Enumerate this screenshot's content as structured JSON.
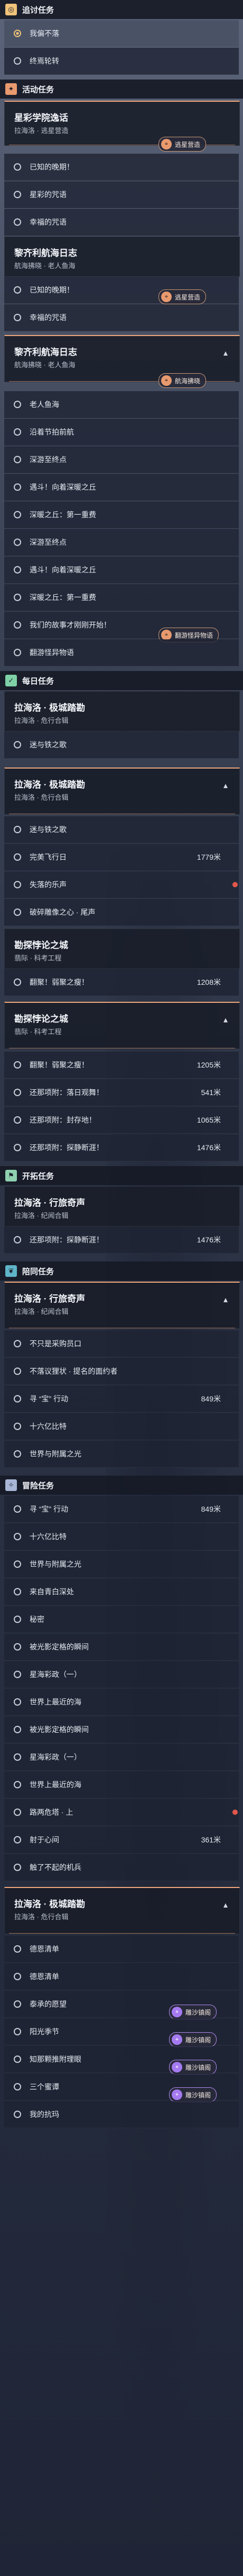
{
  "colors": {
    "accent": "#f1a77b",
    "daily": "#7fd0a6",
    "event": "#e89a6e",
    "feature": "#8fd0b0",
    "companion": "#5fb4c8",
    "purple": "#a57af0"
  },
  "sections": {
    "side": {
      "title": "追讨任务",
      "icon": "target-icon"
    },
    "event": {
      "title": "活动任务",
      "icon": "star-icon"
    },
    "daily": {
      "title": "每日任务",
      "icon": "check-icon"
    },
    "feature": {
      "title": "开拓任务",
      "icon": "flag-icon"
    },
    "companion": {
      "title": "陪同任务",
      "icon": "leaf-icon"
    },
    "adventure": {
      "title": "冒险任务",
      "icon": "compass-icon"
    }
  },
  "side_rows": [
    "我偏不落",
    "终焉轮转"
  ],
  "cards": {
    "c1": {
      "title": "星彩学院逸话",
      "sub": "拉海洛 · 逃星营造"
    },
    "c2": {
      "title": "黎齐利航海日志",
      "sub": "航海拂晓 · 老人鱼海"
    },
    "c3": {
      "title": "黎齐利航海日志",
      "sub": "航海拂晓 · 老人鱼海"
    },
    "c4": {
      "title": "拉海洛 · 极城踏勘",
      "sub": "拉海洛 · 危行合辑"
    },
    "c5": {
      "title": "拉海洛 · 极城踏勘",
      "sub": "拉海洛 · 危行合辑"
    },
    "c6": {
      "title": "勘探悖论之城",
      "sub": "翡际 · 科考工程"
    },
    "c7": {
      "title": "勘探悖论之城",
      "sub": "翡际 · 科考工程"
    },
    "c8": {
      "title": "拉海洛 · 行旅奇声",
      "sub": "拉海洛 · 纪闻合辑"
    },
    "c9": {
      "title": "拉海洛 · 行旅奇声",
      "sub": "拉海洛 · 纪闻合辑"
    },
    "c10": {
      "title": "拉海洛 · 极城踏勘",
      "sub": "拉海洛 · 危行合辑"
    }
  },
  "rows": {
    "c1": [
      "已知的晚期！",
      "星彩的咒语",
      "幸福的咒语"
    ],
    "c2": [
      "已知的晚期！",
      "幸福的咒语"
    ],
    "c3": [
      "老人鱼海",
      "沿着节拍前航",
      "深游至终点",
      "遇斗！向着深暖之丘",
      "深暖之丘：第一重费",
      "深游至终点",
      "遇斗！向着深暖之丘",
      "深暖之丘：第一重费",
      "我们的故事才刚刚开始！",
      "翻游怪异物语"
    ],
    "c4": [
      "迷与铁之歌"
    ],
    "c5": [
      "迷与铁之歌",
      "完美飞行日",
      "失落的乐声",
      "破碎雕像之心 · 尾声"
    ],
    "c6": [
      "翻聚！弱聚之瘦！"
    ],
    "c7": [
      "翻聚！弱聚之瘦！",
      "还那项附：落日观舞！",
      "还那项附：封存地！",
      "还那项附：探静断涯！"
    ],
    "c8": [
      "还那项附：探静断涯！"
    ],
    "c9": [
      "不只是采购员口",
      "不落议狸状 · 提名的面约者",
      "寻 “宝” 行动",
      "十六亿比特",
      "世界与附属之光"
    ],
    "c9b": [
      "寻 “宝” 行动",
      "十六亿比特",
      "世界与附属之光",
      "来自青白深处",
      "秘密",
      "被光影定格的瞬间",
      "星海彩政（一）",
      "世界上最近的海",
      "被光影定格的瞬间",
      "星海彩政（一）",
      "世界上最近的海",
      "路两危塔 · 上",
      "射于心间",
      "触了不起的机兵"
    ],
    "c10": [
      "德恩清单",
      "德恩清单",
      "泰承的愿望",
      "阳光季节",
      "知那颗推附理眼",
      "三个蜜谭",
      "我的抗玛"
    ]
  },
  "distances": {
    "d1": "1779米",
    "d2": "1208米",
    "d3": "1205米",
    "d4": "541米",
    "d5": "1065米",
    "d6": "1476米",
    "d7": "1476米",
    "d8": "849米",
    "d9": "849米",
    "d10": "361米"
  },
  "tags": {
    "t1": "逃星营造",
    "t2": "逃星营造",
    "t3": "航海拂晓",
    "t4": "翻游怪异物语",
    "t5": "雕沙镇阁",
    "t6": "雕沙镇阁",
    "t7": "雕沙镇阁",
    "t8": "雕沙镇阁"
  }
}
